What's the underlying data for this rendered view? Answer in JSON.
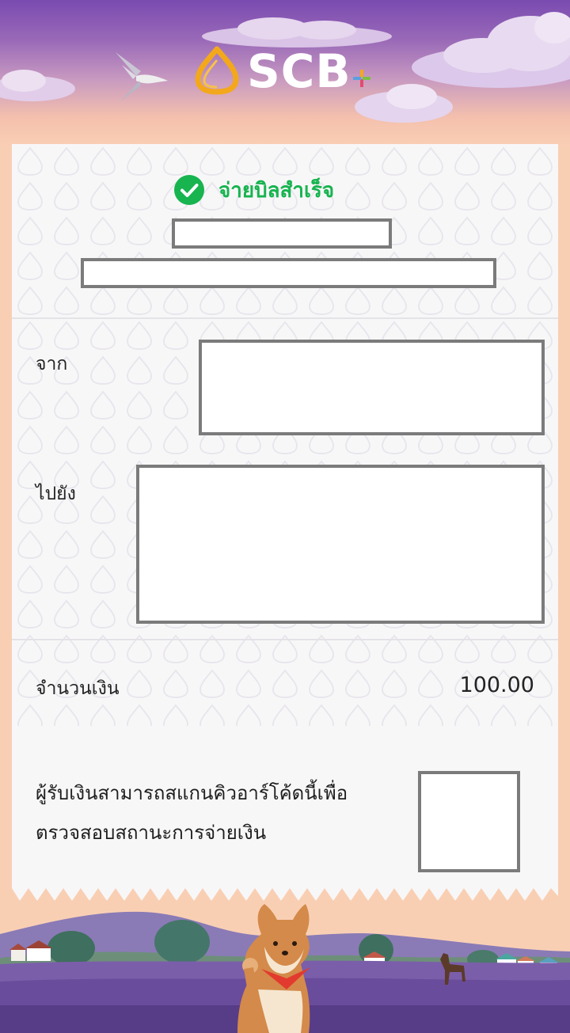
{
  "header": {
    "logo_text": "SCB",
    "brand_colors": {
      "logo_gold": "#f3a81c",
      "plus_colors": [
        "#f3a81c",
        "#e24b6b",
        "#5aa0e0",
        "#7bc043"
      ]
    }
  },
  "receipt": {
    "status_text": "จ่ายบิลสำเร็จ",
    "status_color": "#17b44f",
    "from_label": "จาก",
    "to_label": "ไปยัง",
    "amount_label": "จำนวนเงิน",
    "amount_value": "100.00",
    "qr_note_line1": "ผู้รับเงินสามารถสแกนคิวอาร์โค้ดนี้เพื่อ",
    "qr_note_line2": "ตรวจสอบสถานะการจ่ายเงิน"
  },
  "icons": {
    "check": "check-circle-icon",
    "logo": "scb-logo-icon",
    "bird": "bird-icon",
    "mascot": "shiba-dog-icon"
  }
}
